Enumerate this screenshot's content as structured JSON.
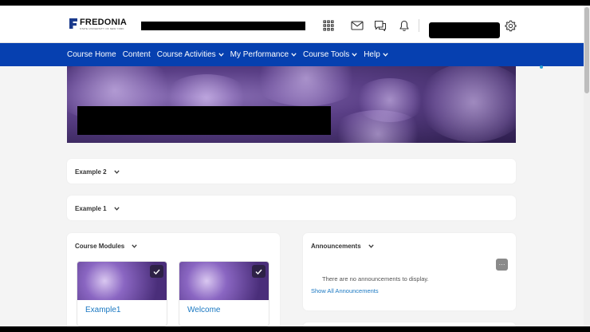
{
  "brand": {
    "name": "FREDONIA",
    "tagline": "STATE UNIVERSITY OF NEW YORK",
    "color": "#1a3a8c"
  },
  "topbar": {
    "icons": [
      "apps-grid-icon",
      "mail-icon",
      "chat-icon",
      "bell-icon",
      "gear-icon"
    ]
  },
  "nav": {
    "color": "#0640b0",
    "items": [
      {
        "label": "Course Home",
        "has_menu": false
      },
      {
        "label": "Content",
        "has_menu": false
      },
      {
        "label": "Course Activities",
        "has_menu": true
      },
      {
        "label": "My Performance",
        "has_menu": true
      },
      {
        "label": "Course Tools",
        "has_menu": true
      },
      {
        "label": "Help",
        "has_menu": true
      }
    ]
  },
  "widgets": {
    "example2": {
      "title": "Example 2"
    },
    "example1": {
      "title": "Example 1"
    },
    "modules": {
      "title": "Course Modules",
      "tiles": [
        {
          "label": "Example1",
          "completed": true
        },
        {
          "label": "Welcome",
          "completed": true
        }
      ]
    },
    "announcements": {
      "title": "Announcements",
      "more_label": "···",
      "empty_text": "There are no announcements to display.",
      "link": "Show All Announcements"
    }
  }
}
